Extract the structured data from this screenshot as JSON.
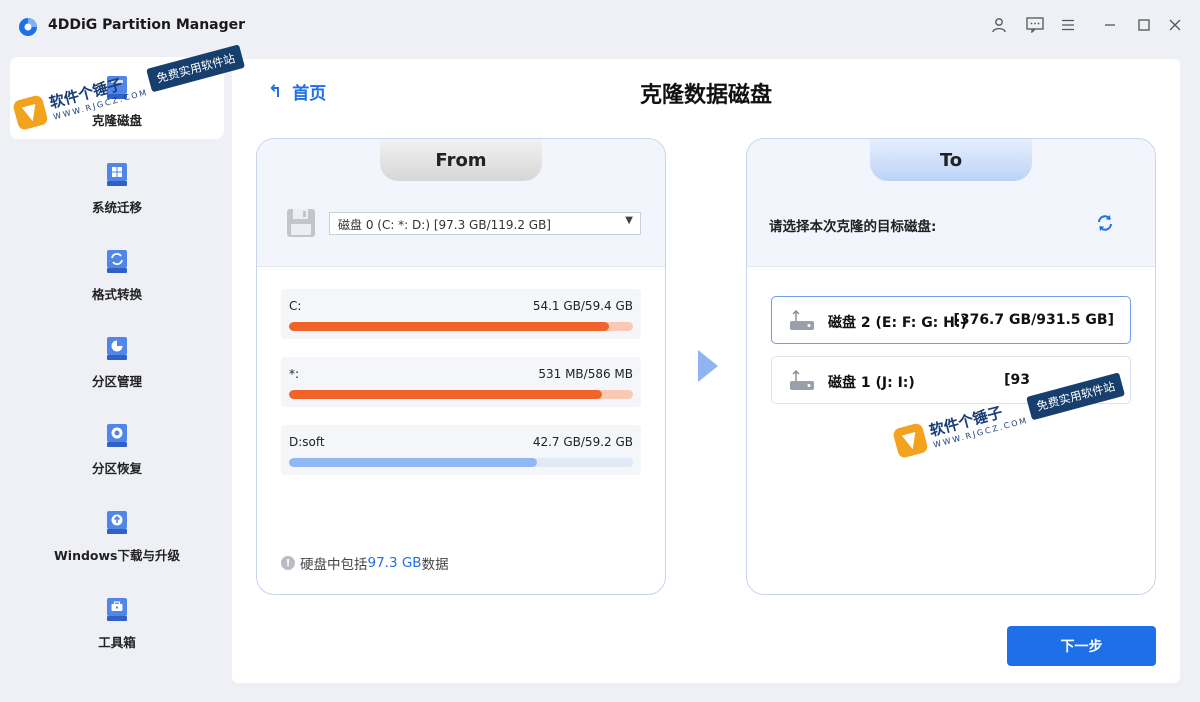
{
  "app": {
    "title": "4DDiG Partition Manager"
  },
  "sidebar": {
    "items": [
      {
        "label": "克隆磁盘",
        "icon": "clone-disk-icon",
        "active": true
      },
      {
        "label": "系统迁移",
        "icon": "system-migrate-icon",
        "active": false
      },
      {
        "label": "格式转换",
        "icon": "format-convert-icon",
        "active": false
      },
      {
        "label": "分区管理",
        "icon": "partition-manage-icon",
        "active": false
      },
      {
        "label": "分区恢复",
        "icon": "partition-recover-icon",
        "active": false
      },
      {
        "label": "Windows下载与升级",
        "icon": "windows-upgrade-icon",
        "active": false
      },
      {
        "label": "工具箱",
        "icon": "toolbox-icon",
        "active": false
      }
    ]
  },
  "header": {
    "home_label": "首页",
    "page_title": "克隆数据磁盘"
  },
  "source": {
    "tab_label": "From",
    "selected_disk": "磁盘 0 (C: *: D:) [97.3 GB/119.2 GB]",
    "partitions": [
      {
        "name": "C:",
        "size": "54.1 GB/59.4 GB",
        "fill": 0.93,
        "color": "#f0642c",
        "track": "#f9c9b3"
      },
      {
        "name": "*:",
        "size": "531 MB/586 MB",
        "fill": 0.91,
        "color": "#f0642c",
        "track": "#f9c9b3"
      },
      {
        "name": "D:soft",
        "size": "42.7 GB/59.2 GB",
        "fill": 0.72,
        "color": "#91b6f4",
        "track": "#e1e8f6"
      }
    ],
    "summary_prefix": "硬盘中包括",
    "summary_value": "97.3 GB",
    "summary_suffix": "数据"
  },
  "target": {
    "tab_label": "To",
    "prompt": "请选择本次克隆的目标磁盘:",
    "disks": [
      {
        "name": "磁盘 2 (E: F: G: H:)",
        "size": "[376.7 GB/931.5 GB]",
        "selected": true
      },
      {
        "name": "磁盘 1 (J: I:)",
        "size": "[93",
        "selected": false
      }
    ]
  },
  "actions": {
    "next_label": "下一步"
  },
  "watermark": {
    "main": "软件个锤子",
    "url": "WWW.RJGCZ.COM",
    "tag": "免费实用软件站"
  },
  "colors": {
    "accent": "#1f6fe8",
    "danger_fill": "#f0642c",
    "normal_fill": "#91b6f4"
  }
}
